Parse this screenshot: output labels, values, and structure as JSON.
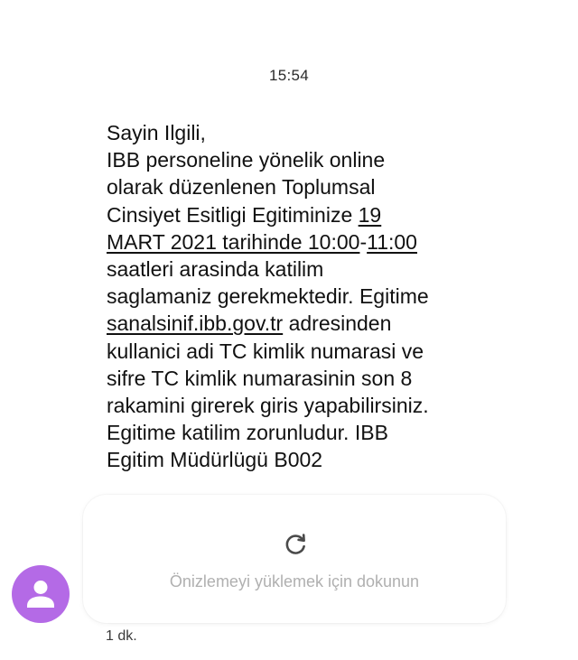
{
  "status": {
    "time": "15:54"
  },
  "message": {
    "lines": [
      [
        {
          "text": "Sayin Ilgili,"
        }
      ],
      [
        {
          "text": "IBB personeline yönelik online"
        }
      ],
      [
        {
          "text": "olarak düzenlenen Toplumsal"
        }
      ],
      [
        {
          "text": "Cinsiyet Esitligi Egitiminize "
        },
        {
          "text": "19",
          "underline": true
        }
      ],
      [
        {
          "text": "MART 2021 tarihinde 10:00",
          "underline": true
        },
        {
          "text": "-"
        },
        {
          "text": "11:00",
          "underline": true
        }
      ],
      [
        {
          "text": "saatleri arasinda katilim"
        }
      ],
      [
        {
          "text": "saglamaniz gerekmektedir. Egitime"
        }
      ],
      [
        {
          "text": "sanalsinif.ibb.gov.tr",
          "underline": true
        },
        {
          "text": " adresinden"
        }
      ],
      [
        {
          "text": "kullanici adi TC kimlik numarasi ve"
        }
      ],
      [
        {
          "text": "sifre TC kimlik numarasinin son 8"
        }
      ],
      [
        {
          "text": "rakamini girerek giris yapabilirsiniz."
        }
      ],
      [
        {
          "text": "Egitime katilim zorunludur. IBB"
        }
      ],
      [
        {
          "text": "Egitim Müdürlügü B002"
        }
      ]
    ]
  },
  "preview": {
    "label": "Önizlemeyi yüklemek için dokunun",
    "icon": "reload-icon"
  },
  "sender": {
    "avatar_icon": "person-icon",
    "avatar_color": "#b46ae6"
  },
  "meta": {
    "age": "1 dk."
  }
}
